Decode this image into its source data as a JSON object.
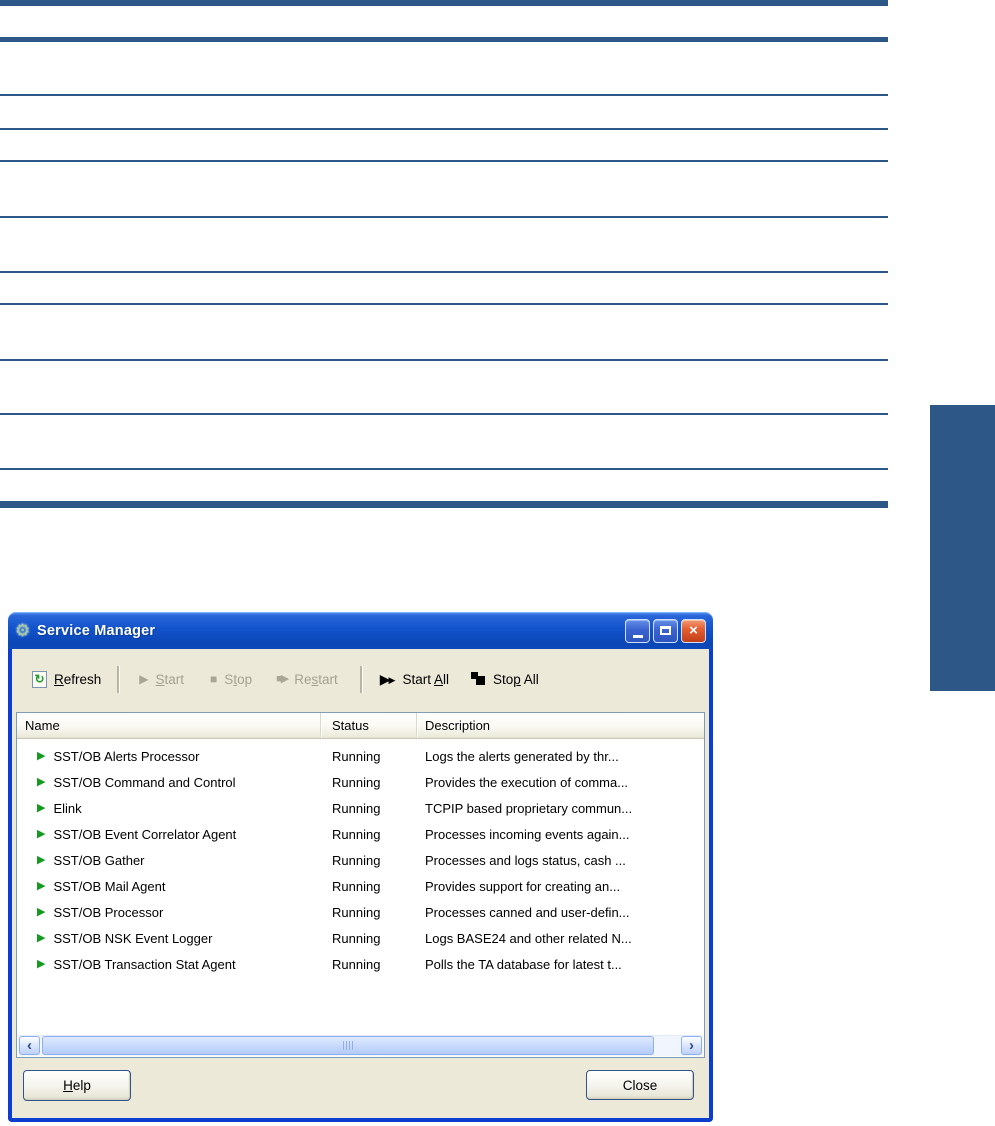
{
  "colors": {
    "accent_rule": "#2d5787",
    "window_border": "#0c3dcd",
    "titlebar_blue": "#1253cc",
    "window_body": "#ece9d8",
    "running_green": "#149a1f",
    "disabled_text": "#a5a18f"
  },
  "icons": {
    "gear": "⚙",
    "titlebar_close": "×",
    "refresh": "↻",
    "play": "▶",
    "stop": "■",
    "restart_square": "■",
    "restart_play": "▶",
    "start_all_big": "▶",
    "start_all_small": "▶",
    "running_triangle": "▶",
    "scroll_left": "‹",
    "scroll_right": "›"
  },
  "window": {
    "title": "Service Manager",
    "toolbar": {
      "buttons": [
        {
          "id": "refresh",
          "pre": "",
          "key": "R",
          "post": "efresh",
          "enabled": true
        },
        {
          "id": "start",
          "pre": "",
          "key": "S",
          "post": "tart",
          "enabled": false
        },
        {
          "id": "stop",
          "pre": "S",
          "key": "t",
          "post": "op",
          "enabled": false
        },
        {
          "id": "restart",
          "pre": "Re",
          "key": "s",
          "post": "tart",
          "enabled": false
        },
        {
          "id": "start-all",
          "pre": "Start ",
          "key": "A",
          "post": "ll",
          "enabled": true
        },
        {
          "id": "stop-all",
          "pre": "Sto",
          "key": "p",
          "post": " All",
          "enabled": true
        }
      ]
    },
    "list": {
      "columns": [
        "Name",
        "Status",
        "Description"
      ],
      "rows": [
        {
          "name": "SST/OB Alerts Processor",
          "status": "Running",
          "description": "Logs the alerts generated by thr..."
        },
        {
          "name": "SST/OB Command and Control",
          "status": "Running",
          "description": "Provides the execution of comma..."
        },
        {
          "name": "Elink",
          "status": "Running",
          "description": "TCPIP based proprietary commun..."
        },
        {
          "name": "SST/OB Event Correlator Agent",
          "status": "Running",
          "description": "Processes incoming events again..."
        },
        {
          "name": "SST/OB Gather",
          "status": "Running",
          "description": "Processes and logs status, cash ..."
        },
        {
          "name": "SST/OB Mail Agent",
          "status": "Running",
          "description": "Provides support for creating an..."
        },
        {
          "name": "SST/OB Processor",
          "status": "Running",
          "description": "Processes canned and user-defin..."
        },
        {
          "name": "SST/OB NSK Event Logger",
          "status": "Running",
          "description": "Logs BASE24 and other related N..."
        },
        {
          "name": "SST/OB Transaction Stat Agent",
          "status": "Running",
          "description": "Polls the TA database for latest t..."
        }
      ]
    },
    "footer": {
      "help": {
        "pre": "",
        "key": "H",
        "post": "elp"
      },
      "close_label": "Close"
    }
  }
}
